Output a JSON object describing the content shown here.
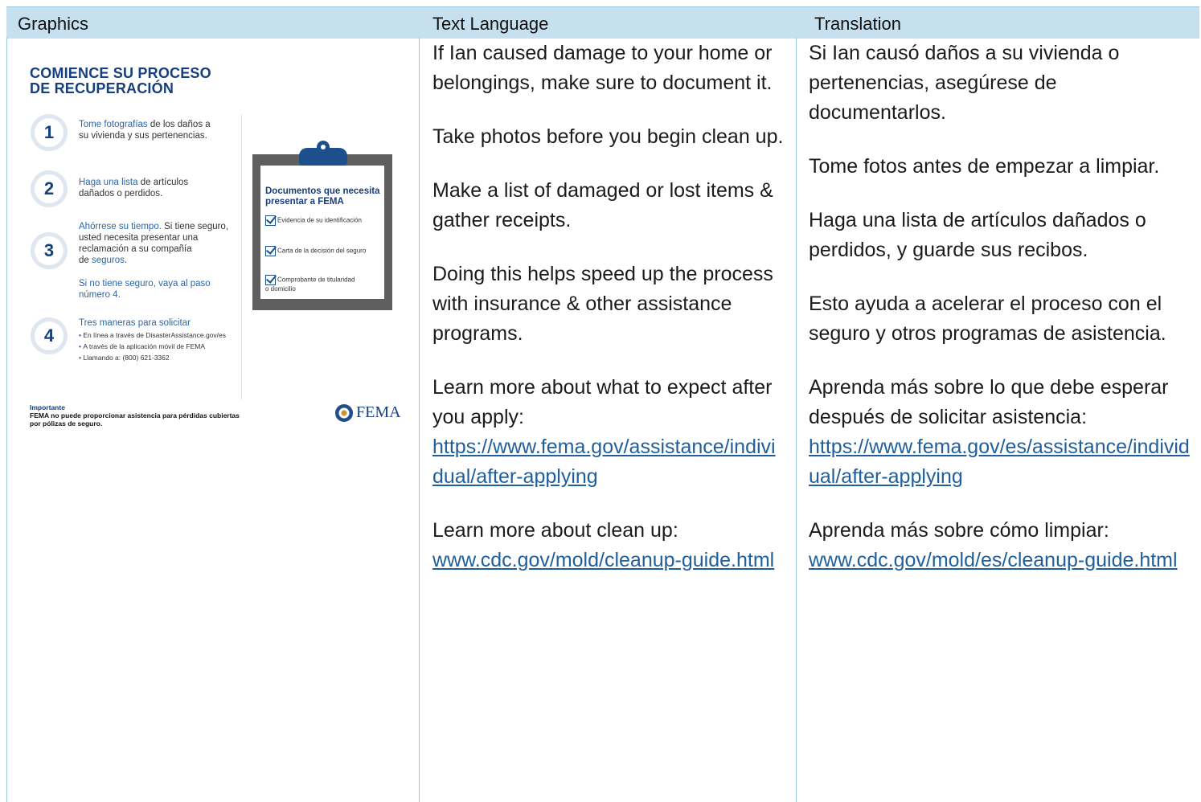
{
  "header": {
    "col1": "Graphics",
    "col2": "Text Language",
    "col3": "Translation"
  },
  "graphic": {
    "title": "COMIENCE SU PROCESO\nDE RECUPERACIÓN",
    "steps": [
      {
        "num": "1",
        "highlight": "Tome fotografías",
        "rest": " de los daños a\nsu vivienda y sus pertenencias."
      },
      {
        "num": "2",
        "highlight": "Haga una lista",
        "rest": " de artículos\ndañados o perdidos."
      },
      {
        "num": "3",
        "highlight": "Ahórrese su tiempo.",
        "rest": " Si tiene seguro,\nusted necesita presentar una\nreclamación a su compañía\nde ",
        "link": "seguros",
        "after": ".",
        "note": "Si no tiene seguro, vaya al paso\nnúmero 4."
      },
      {
        "num": "4",
        "highlight": "Tres maneras para solicitar",
        "bullets": [
          "En línea a través de DisasterAssistance.gov/es",
          "A través de la aplicación móvil de FEMA",
          "Llamando a: (800) 621-3362"
        ]
      }
    ],
    "clipboard": {
      "title": "Documentos que necesita\npresentar a FEMA",
      "items": [
        "Evidencia de su identificación",
        "Carta de la decisión del seguro",
        "Comprobante de titularidad\no domicilio"
      ]
    },
    "important_heading": "Importante",
    "important_text": "FEMA no puede proporcionar asistencia para pérdidas cubiertas\npor pólizas de seguro.",
    "logo_text": "FEMA"
  },
  "english": {
    "p1": "If Ian caused damage to your home or belongings, make sure to document it.",
    "p2": "Take photos before you begin clean up.",
    "p3": "Make a list of damaged or lost items & gather receipts.",
    "p4": "Doing this helps speed up the process with insurance & other assistance programs.",
    "p5": "Learn more about what to expect after you apply:",
    "link1": "https://www.fema.gov/assistance/individual/after-applying",
    "p6": "Learn more about clean up:",
    "link2": "www.cdc.gov/mold/cleanup-guide.html"
  },
  "spanish": {
    "p1": "Si Ian causó daños a su vivienda o pertenencias, asegúrese de documentarlos.",
    "p2": "Tome fotos antes de empezar a limpiar.",
    "p3": "Haga una lista de artículos dañados o perdidos, y guarde sus recibos.",
    "p4": "Esto ayuda a acelerar el proceso con el seguro y otros programas de asistencia.",
    "p5": "Aprenda más sobre lo que debe esperar después de solicitar asistencia:",
    "link1": "https://www.fema.gov/es/assistance/individual/after-applying",
    "p6": "Aprenda más sobre cómo limpiar:",
    "link2": "www.cdc.gov/mold/es/cleanup-guide.html"
  }
}
